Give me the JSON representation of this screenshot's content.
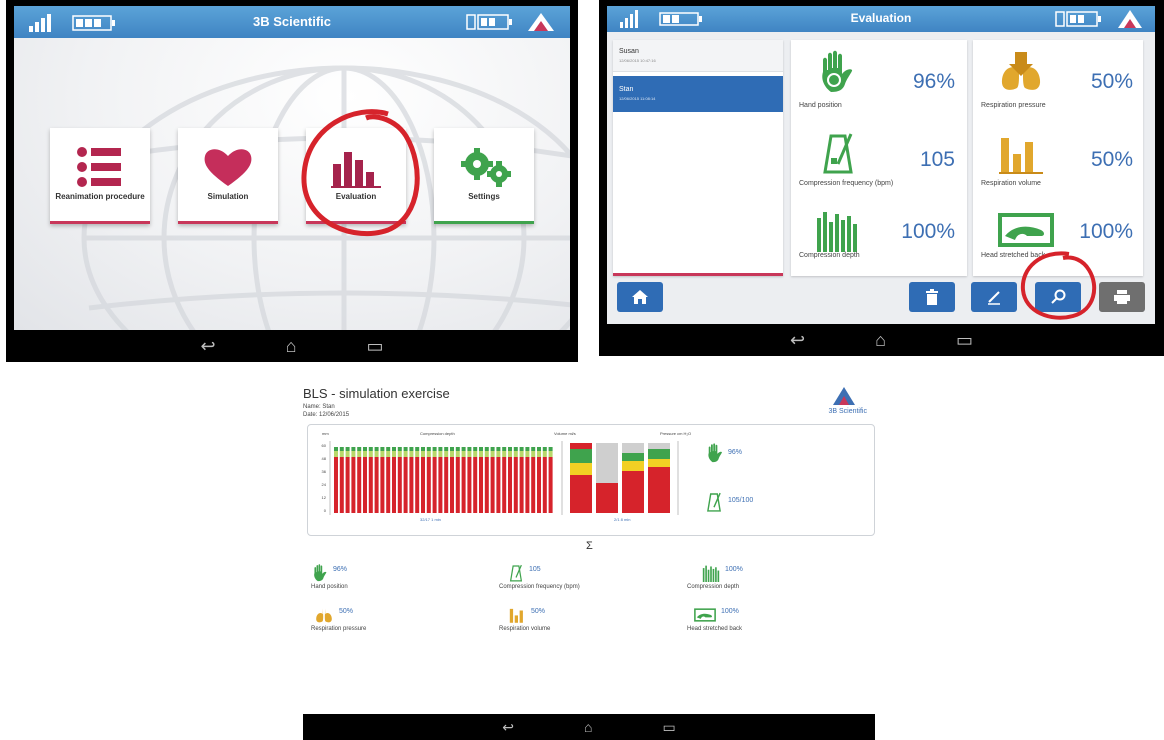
{
  "screen_main": {
    "title": "3B Scientific",
    "tiles": [
      {
        "label": "Reanimation procedure",
        "icon": "list-icon"
      },
      {
        "label": "Simulation",
        "icon": "heart-icon"
      },
      {
        "label": "Evaluation",
        "icon": "bar-chart-icon"
      },
      {
        "label": "Settings",
        "icon": "gears-icon"
      }
    ],
    "colors": {
      "accent": "#c8375a",
      "green": "#3fa34d",
      "header": "#4a90cf"
    }
  },
  "screen_eval": {
    "title": "Evaluation",
    "sessions": [
      {
        "name": "Susan",
        "time": "12/06/2015 10:47:16"
      },
      {
        "name": "Stan",
        "time": "12/06/2015 11:08:14"
      }
    ],
    "metrics": [
      {
        "label": "Hand position",
        "value": "96%",
        "icon": "hand-icon"
      },
      {
        "label": "Respiration pressure",
        "value": "50%",
        "icon": "lungs-icon"
      },
      {
        "label": "Compression frequency (bpm)",
        "value": "105",
        "icon": "metronome-icon"
      },
      {
        "label": "Respiration volume",
        "value": "50%",
        "icon": "volume-bars-icon"
      },
      {
        "label": "Compression depth",
        "value": "100%",
        "icon": "depth-bars-icon"
      },
      {
        "label": "Head stretched back",
        "value": "100%",
        "icon": "head-tilt-icon"
      }
    ]
  },
  "report": {
    "title": "BLS - simulation exercise",
    "name_line": "Name: Stan",
    "date_line": "Date: 12/06/2015",
    "brand": "3B Scientific",
    "chart_left_title": "Compression depth",
    "chart_left_unit": "mm",
    "chart_left_yticks": [
      "60",
      "48",
      "36",
      "24",
      "12",
      "0"
    ],
    "chart_left_xlabel": "32/17  1 min",
    "chart_mid_title": "Volume ml/s",
    "chart_right_title": "Pressure cm H₂O",
    "chart_mid_xlabel": "2/1  8 min",
    "side_hand": "96%",
    "side_freq": "105/100",
    "sigma": "Σ",
    "summary": [
      {
        "label": "Hand position",
        "value": "96%"
      },
      {
        "label": "Compression frequency (bpm)",
        "value": "105"
      },
      {
        "label": "Compression depth",
        "value": "100%"
      },
      {
        "label": "Respiration pressure",
        "value": "50%"
      },
      {
        "label": "Respiration volume",
        "value": "50%"
      },
      {
        "label": "Head stretched back",
        "value": "100%"
      }
    ]
  }
}
